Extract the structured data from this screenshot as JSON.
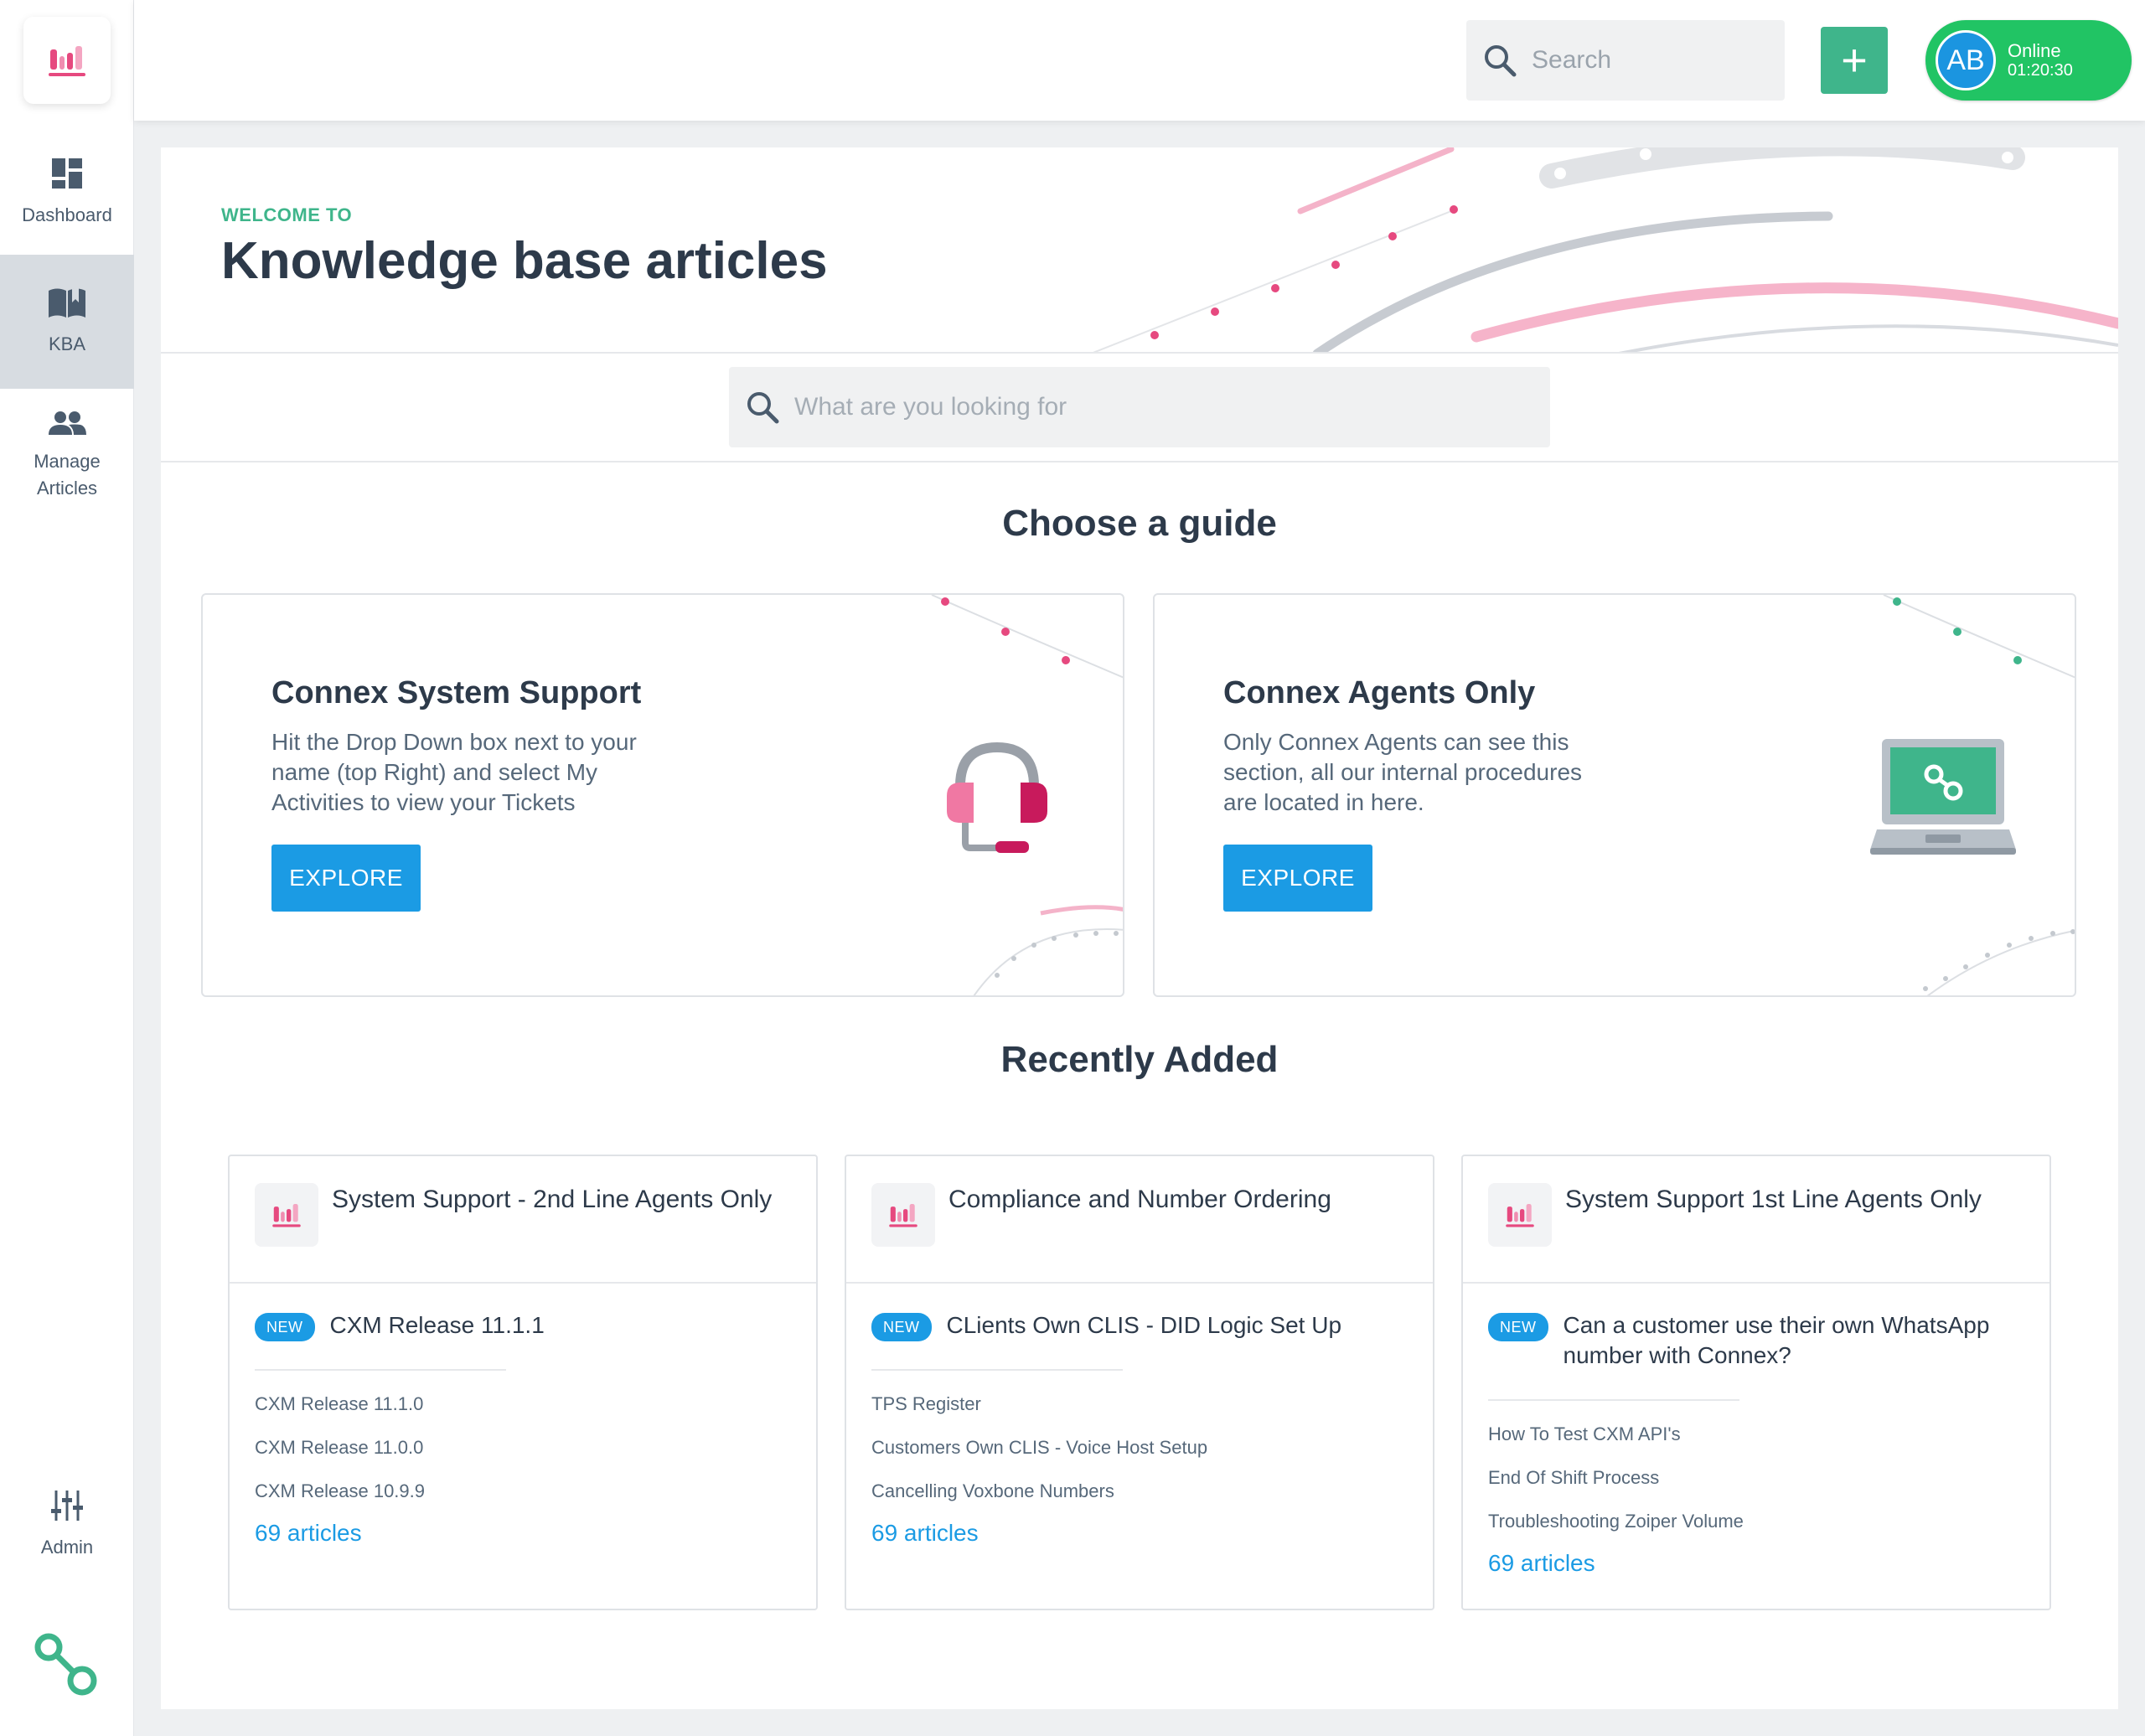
{
  "sidebar": {
    "logo_icon": "connex-logo-icon",
    "items": [
      {
        "label": "Dashboard",
        "icon": "dashboard-icon"
      },
      {
        "label": "KBA",
        "icon": "book-icon",
        "active": true
      },
      {
        "label": "Manage Articles",
        "icon": "users-icon"
      },
      {
        "label": "Admin",
        "icon": "sliders-icon"
      }
    ],
    "footer_icon": "connex-link-icon"
  },
  "topbar": {
    "search_placeholder": "Search",
    "add_label": "+",
    "user": {
      "initials": "AB",
      "status": "Online",
      "timer": "01:20:30"
    }
  },
  "hero": {
    "welcome": "WELCOME TO",
    "title": "Knowledge base articles"
  },
  "kb_search": {
    "placeholder": "What are you looking for"
  },
  "guides": {
    "heading": "Choose a guide",
    "cards": [
      {
        "title": "Connex System Support",
        "description": "Hit the Drop Down box next to your name (top Right) and select My Activities to view your Tickets",
        "button": "EXPLORE",
        "illustration": "headset-icon"
      },
      {
        "title": "Connex Agents Only",
        "description": "Only Connex Agents can see this section, all our internal procedures are located in here.",
        "button": "EXPLORE",
        "illustration": "laptop-icon"
      }
    ]
  },
  "recent": {
    "heading": "Recently Added",
    "badge": "NEW",
    "cards": [
      {
        "title": "System Support - 2nd Line Agents Only",
        "feature": "CXM Release 11.1.1",
        "articles": [
          "CXM Release 11.1.0",
          "CXM Release 11.0.0",
          "CXM Release 10.9.9"
        ],
        "count": "69 articles"
      },
      {
        "title": "Compliance and Number Ordering",
        "feature": "CLients Own CLIS - DID Logic Set Up",
        "articles": [
          "TPS Register",
          "Customers Own CLIS - Voice Host Setup",
          "Cancelling Voxbone Numbers"
        ],
        "count": "69 articles"
      },
      {
        "title": "System Support 1st Line Agents Only",
        "feature": "Can a customer use their own WhatsApp number with Connex?",
        "articles": [
          "How To Test CXM API's",
          "End Of Shift Process",
          "Troubleshooting Zoiper Volume"
        ],
        "count": "69 articles"
      }
    ]
  },
  "colors": {
    "accent_green": "#3fb58b",
    "primary_blue": "#1b9be4",
    "brand_pink": "#e6497f",
    "online_green": "#21c464"
  }
}
